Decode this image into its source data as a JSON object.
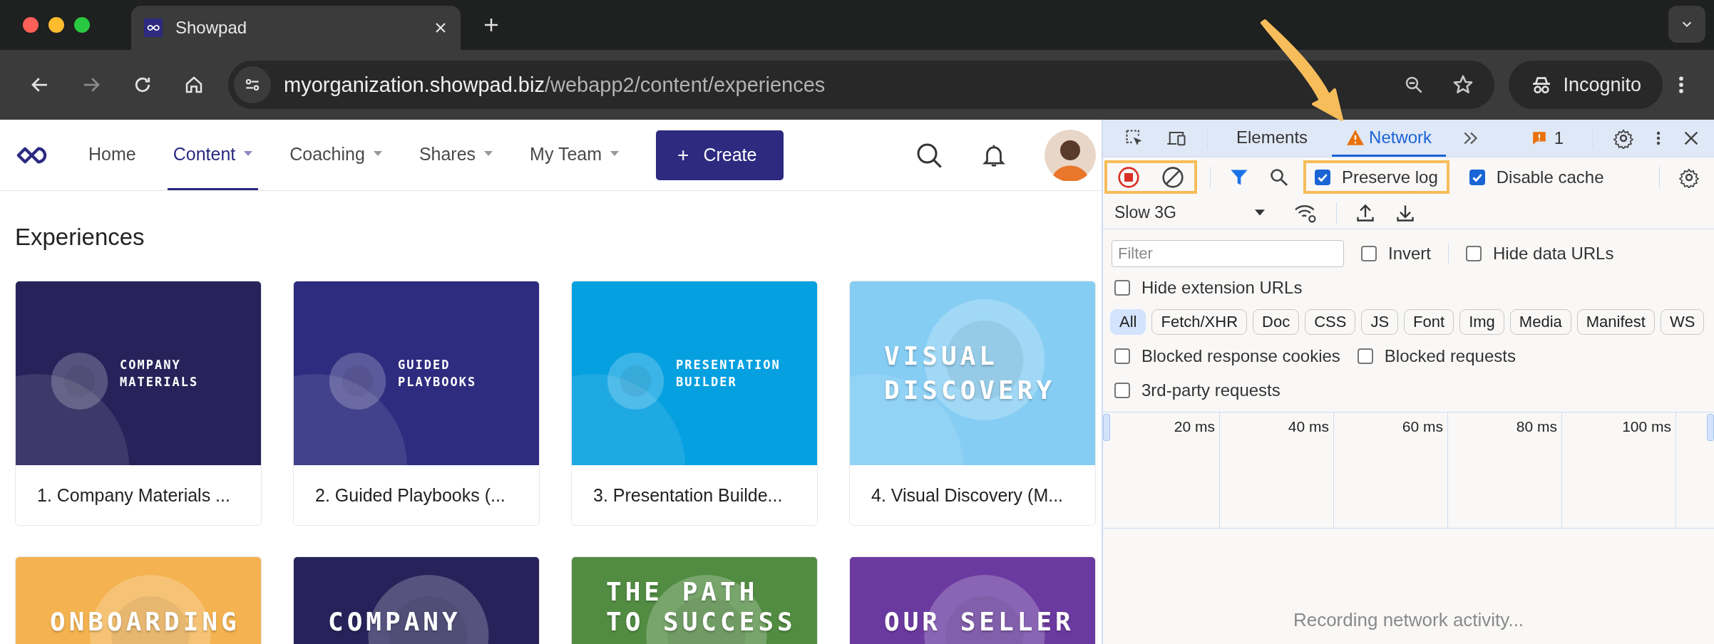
{
  "browser": {
    "tab_title": "Showpad",
    "url_host": "myorganization.showpad.biz",
    "url_path": "/webapp2/content/experiences",
    "profile_label": "Incognito"
  },
  "app": {
    "nav": [
      {
        "label": "Home",
        "selected": false,
        "has_menu": false
      },
      {
        "label": "Content",
        "selected": true,
        "has_menu": true
      },
      {
        "label": "Coaching",
        "selected": false,
        "has_menu": true
      },
      {
        "label": "Shares",
        "selected": false,
        "has_menu": true
      },
      {
        "label": "My Team",
        "selected": false,
        "has_menu": true
      }
    ],
    "create_button": {
      "icon": "+",
      "label": "Create"
    },
    "heading": "Experiences",
    "cards": [
      {
        "kind": "small",
        "color": "#27235a",
        "cover_lines": [
          "COMPANY",
          "MATERIALS"
        ],
        "caption": "1. Company Materials ..."
      },
      {
        "kind": "small",
        "color": "#2d2c7f",
        "cover_lines": [
          "GUIDED",
          "PLAYBOOKS"
        ],
        "caption": "2. Guided Playbooks (..."
      },
      {
        "kind": "small",
        "color": "#05a0e0",
        "cover_lines": [
          "PRESENTATION",
          "BUILDER"
        ],
        "caption": "3. Presentation Builde..."
      },
      {
        "kind": "large",
        "color": "#86cdf4",
        "cover_lines": [
          "VISUAL",
          "DISCOVERY"
        ],
        "caption": "4. Visual Discovery (M..."
      },
      {
        "kind": "large",
        "color": "#f4b350",
        "cover_lines": [
          "ONBOARDING"
        ]
      },
      {
        "kind": "large",
        "color": "#27235a",
        "cover_lines": [
          "COMPANY"
        ]
      },
      {
        "kind": "large",
        "color": "#528c42",
        "cover_lines": [
          "THE PATH",
          "TO SUCCESS"
        ]
      },
      {
        "kind": "large",
        "color": "#6b3aa0",
        "cover_lines": [
          "OUR SELLER"
        ]
      }
    ]
  },
  "devtools": {
    "tabs": [
      {
        "label": "Elements",
        "selected": false,
        "warning": false
      },
      {
        "label": "Network",
        "selected": true,
        "warning": true
      }
    ],
    "issues_count": "1",
    "recording": true,
    "record_group_highlighted": true,
    "preserve_log": {
      "label": "Preserve log",
      "checked": true,
      "highlighted": true
    },
    "disable_cache": {
      "label": "Disable cache",
      "checked": true,
      "highlighted": false
    },
    "throttling": "Slow 3G",
    "filter": {
      "placeholder": "Filter"
    },
    "invert": {
      "label": "Invert",
      "checked": false
    },
    "hide_data_urls": {
      "label": "Hide data URLs",
      "checked": false
    },
    "hide_extension_urls": {
      "label": "Hide extension URLs",
      "checked": false
    },
    "type_chips": [
      {
        "label": "All",
        "selected": true
      },
      {
        "label": "Fetch/XHR",
        "selected": false
      },
      {
        "label": "Doc",
        "selected": false
      },
      {
        "label": "CSS",
        "selected": false
      },
      {
        "label": "JS",
        "selected": false
      },
      {
        "label": "Font",
        "selected": false
      },
      {
        "label": "Img",
        "selected": false
      },
      {
        "label": "Media",
        "selected": false
      },
      {
        "label": "Manifest",
        "selected": false
      },
      {
        "label": "WS",
        "selected": false
      }
    ],
    "blocked_options": [
      {
        "label": "Blocked response cookies",
        "checked": false
      },
      {
        "label": "Blocked requests",
        "checked": false
      }
    ],
    "third_party": {
      "label": "3rd-party requests",
      "checked": false
    },
    "timeline_ticks": [
      "20 ms",
      "40 ms",
      "60 ms",
      "80 ms",
      "100 ms"
    ],
    "status": "Recording network activity..."
  }
}
